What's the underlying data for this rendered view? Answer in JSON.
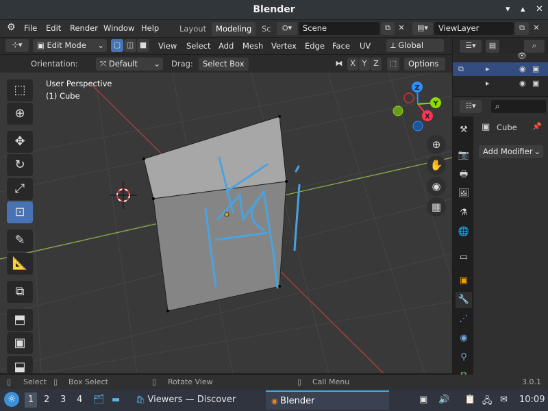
{
  "window": {
    "title": "Blender",
    "min": "▾",
    "max": "▴",
    "close": "✕"
  },
  "menubar": {
    "items": [
      "File",
      "Edit",
      "Render",
      "Window",
      "Help"
    ],
    "tabs": [
      "Layout",
      "Modeling",
      "Sc"
    ],
    "scene": "Scene",
    "view_layer": "ViewLayer"
  },
  "header": {
    "mode": "Edit Mode",
    "menus": [
      "View",
      "Select",
      "Add",
      "Mesh",
      "Vertex",
      "Edge",
      "Face",
      "UV"
    ],
    "transform": "Global"
  },
  "tool_settings": {
    "orientation_label": "Orientation:",
    "orientation_value": "Default",
    "drag_label": "Drag:",
    "drag_value": "Select Box",
    "axes": [
      "X",
      "Y",
      "Z"
    ],
    "options": "Options"
  },
  "viewport": {
    "perspective": "User Perspective",
    "object": "(1) Cube",
    "gizmo": {
      "z": "Z",
      "y": "Y",
      "x": "X"
    }
  },
  "properties": {
    "object_name": "Cube",
    "add_modifier": "Add Modifier"
  },
  "statusbar": {
    "select": "Select",
    "box_select": "Box Select",
    "rotate": "Rotate View",
    "call_menu": "Call Menu",
    "version": "3.0.1"
  },
  "taskbar": {
    "desktops": [
      "1",
      "2",
      "3",
      "4"
    ],
    "discover": "Viewers — Discover",
    "blender": "Blender",
    "time": "10:09"
  },
  "colors": {
    "accent": "#4772b3",
    "x_axis": "#ff3352",
    "y_axis": "#8bdc00",
    "z_axis": "#2890ff",
    "grease_pencil": "#4aa3e0"
  }
}
